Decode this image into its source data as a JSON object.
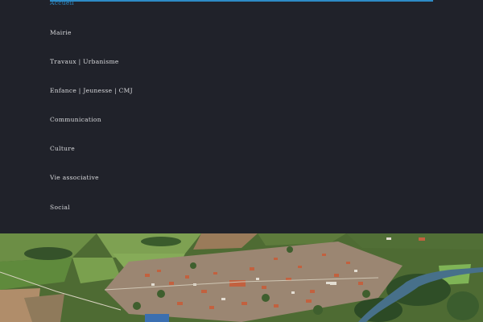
{
  "menu": {
    "accent_color": "#2d8bc6",
    "items": [
      {
        "label": "Accueil",
        "active": true
      },
      {
        "label": "Mairie",
        "active": false
      },
      {
        "label": "Travaux | Urbanisme",
        "active": false
      },
      {
        "label": "Enfance | Jeunesse | CMJ",
        "active": false
      },
      {
        "label": "Communication",
        "active": false
      },
      {
        "label": "Culture",
        "active": false
      },
      {
        "label": "Vie associative",
        "active": false
      },
      {
        "label": "Social",
        "active": false
      }
    ]
  },
  "hero": {
    "image_subject": "aerial-town-photo"
  }
}
